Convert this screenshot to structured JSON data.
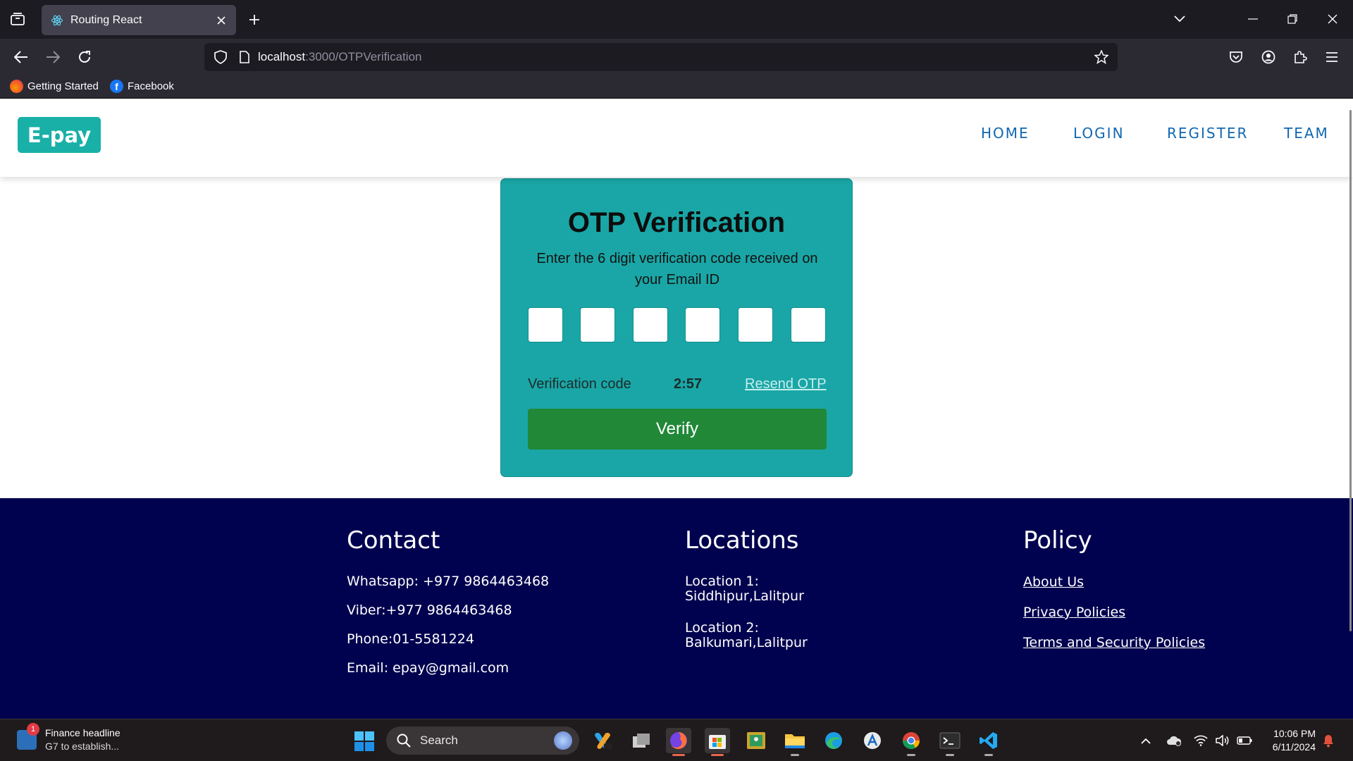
{
  "browser": {
    "tab_title": "Routing React",
    "url_host": "localhost",
    "url_path": ":3000/OTPVerification",
    "bookmarks": [
      "Getting Started",
      "Facebook"
    ]
  },
  "site": {
    "logo": "E-pay",
    "nav": [
      "HOME",
      "LOGIN",
      "REGISTER",
      "TEAM"
    ]
  },
  "otp": {
    "title": "OTP Verification",
    "description": "Enter the 6 digit verification code received on your Email ID",
    "digits": [
      "",
      "",
      "",
      "",
      "",
      ""
    ],
    "label": "Verification code",
    "timer": "2:57",
    "resend": "Resend OTP",
    "verify": "Verify"
  },
  "footer": {
    "contact": {
      "heading": "Contact",
      "lines": [
        "Whatsapp: +977 9864463468",
        "Viber:+977 9864463468",
        "Phone:01-5581224",
        "Email: epay@gmail.com"
      ]
    },
    "locations": {
      "heading": "Locations",
      "items": [
        {
          "label": "Location 1:",
          "place": "Siddhipur,Lalitpur"
        },
        {
          "label": "Location 2:",
          "place": "Balkumari,Lalitpur"
        }
      ]
    },
    "policy": {
      "heading": "Policy",
      "links": [
        "About Us",
        "Privacy Policies",
        "Terms and Security Policies"
      ]
    }
  },
  "taskbar": {
    "news_title": "Finance headline",
    "news_sub": "G7 to establish...",
    "news_badge": "1",
    "search_placeholder": "Search",
    "time": "10:06 PM",
    "date": "6/11/2024"
  },
  "colors": {
    "brand": "#19b0a8",
    "card": "#1aa6a6",
    "verify_button": "#218838",
    "footer": "#01024f",
    "nav_link": "#1167b1"
  }
}
